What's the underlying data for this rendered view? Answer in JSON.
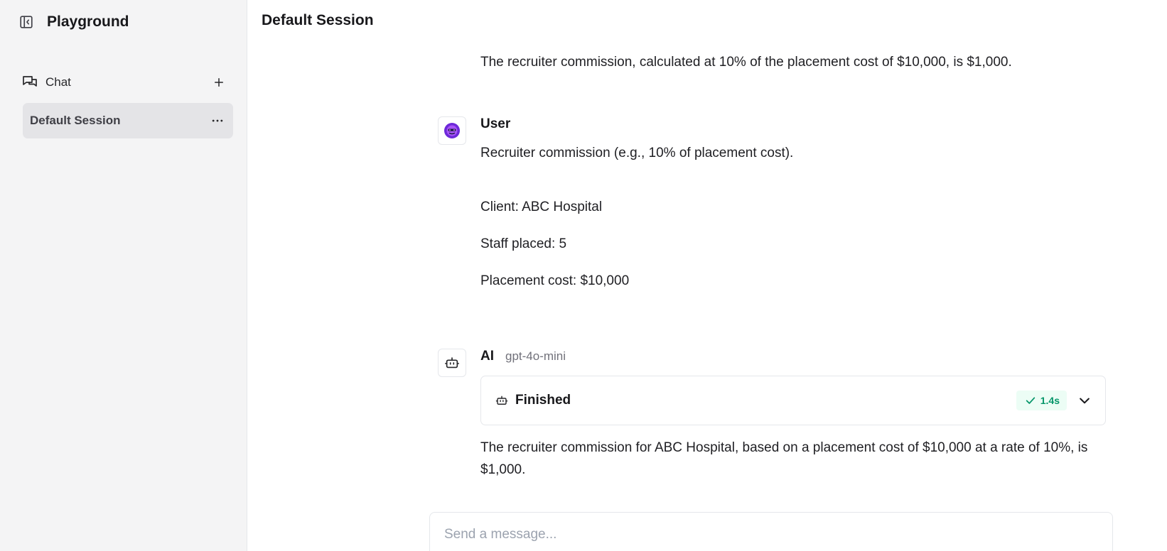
{
  "sidebar": {
    "app_title": "Playground",
    "nav_chat_label": "Chat",
    "session_label": "Default Session"
  },
  "main": {
    "session_title": "Default Session",
    "previous_ai_text": "The recruiter commission, calculated at 10% of the placement cost of $10,000, is $1,000.",
    "user_message": {
      "role": "User",
      "lines": [
        "Recruiter commission (e.g., 10% of placement cost).",
        "Client: ABC Hospital",
        "Staff placed: 5",
        "Placement cost: $10,000"
      ]
    },
    "ai_message": {
      "role": "AI",
      "model": "gpt-4o-mini",
      "tool_status": "Finished",
      "tool_timing": "1.4s",
      "answer": "The recruiter commission for ABC Hospital, based on a placement cost of $10,000 at a rate of 10%, is $1,000."
    }
  },
  "composer": {
    "placeholder": "Send a message..."
  },
  "icons": {
    "sidebar_toggle": "panel-left-icon",
    "chat": "messages-icon",
    "new_chat": "plus-icon",
    "session_menu": "more-horizontal-icon",
    "user_avatar": "user-avatar-icon",
    "ai_avatar": "bot-icon",
    "tool": "bot-icon",
    "check": "check-icon",
    "expand": "chevron-down-icon"
  },
  "colors": {
    "accent_success": "#059669",
    "avatar_purple": "#6d28d9"
  }
}
